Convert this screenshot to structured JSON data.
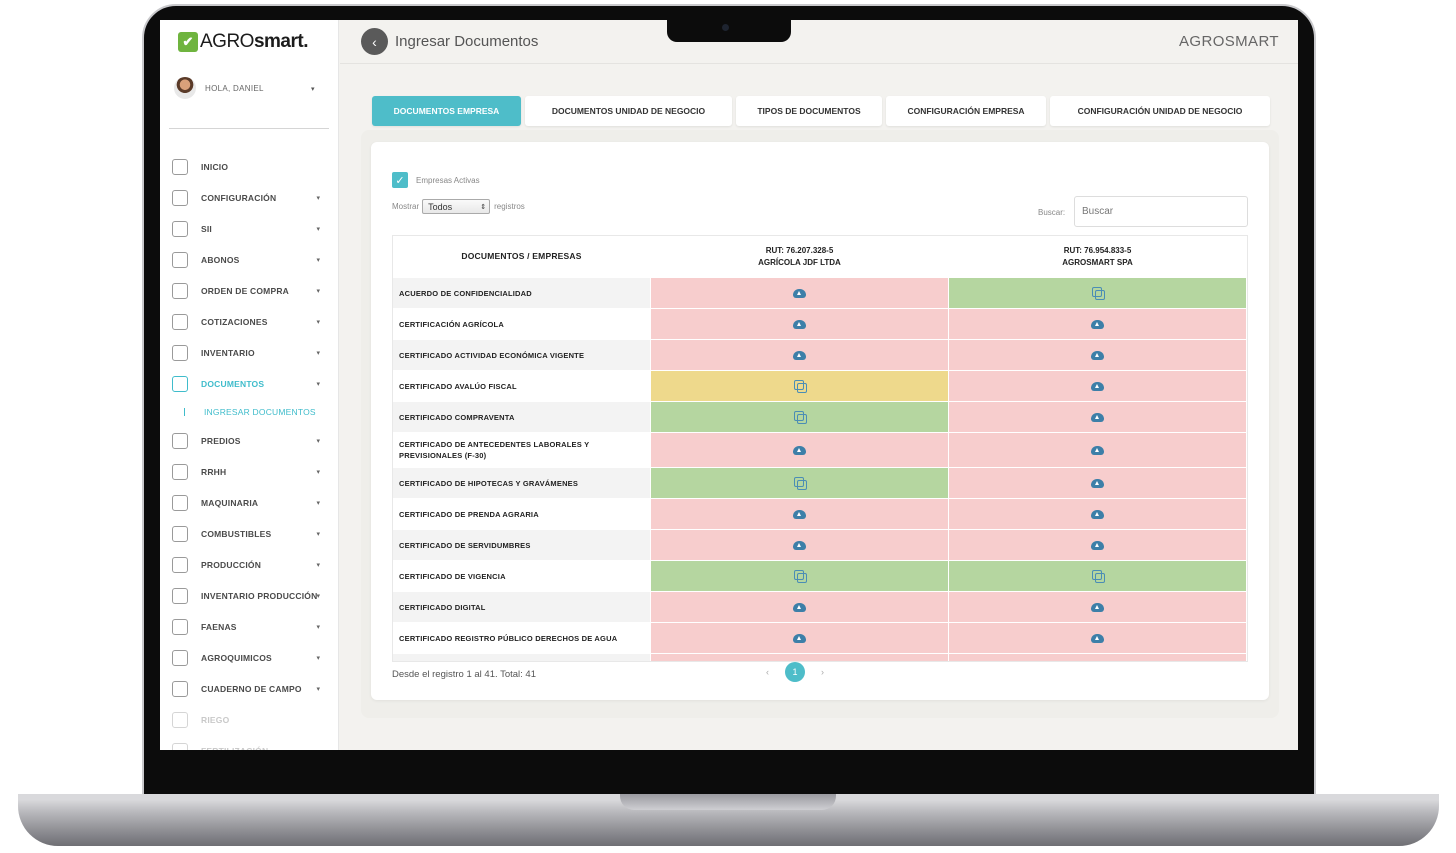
{
  "logo": {
    "mark": "✔",
    "prefix": "AGRO",
    "suffix": "smart."
  },
  "user": {
    "greeting": "HOLA, DANIEL"
  },
  "nav": [
    {
      "label": "INICIO",
      "icon": "dashboard-icon",
      "arrow": ""
    },
    {
      "label": "CONFIGURACIÓN",
      "icon": "gear-icon",
      "arrow": "▾"
    },
    {
      "label": "SII",
      "icon": "invoice-icon",
      "arrow": "▾"
    },
    {
      "label": "ABONOS",
      "icon": "card-icon",
      "arrow": "▾"
    },
    {
      "label": "ORDEN DE COMPRA",
      "icon": "cart-icon",
      "arrow": "▾"
    },
    {
      "label": "COTIZACIONES",
      "icon": "cart-icon",
      "arrow": "▾"
    },
    {
      "label": "INVENTARIO",
      "icon": "tag-icon",
      "arrow": "▾"
    },
    {
      "label": "DOCUMENTOS",
      "icon": "document-icon",
      "arrow": "▾"
    },
    {
      "label": "INGRESAR DOCUMENTOS",
      "icon": "",
      "arrow": ""
    },
    {
      "label": "PREDIOS",
      "icon": "landscape-icon",
      "arrow": "▾"
    },
    {
      "label": "RRHH",
      "icon": "id-card-icon",
      "arrow": "▾"
    },
    {
      "label": "MAQUINARIA",
      "icon": "tractor-icon",
      "arrow": "▾"
    },
    {
      "label": "COMBUSTIBLES",
      "icon": "fuel-icon",
      "arrow": "▾"
    },
    {
      "label": "PRODUCCIÓN",
      "icon": "route-icon",
      "arrow": "▾"
    },
    {
      "label": "INVENTARIO PRODUCCIÓN",
      "icon": "tag-icon",
      "arrow": "▾"
    },
    {
      "label": "FAENAS",
      "icon": "tools-icon",
      "arrow": "▾"
    },
    {
      "label": "AGROQUIMICOS",
      "icon": "calendar-icon",
      "arrow": "▾"
    },
    {
      "label": "CUADERNO DE CAMPO",
      "icon": "notebook-icon",
      "arrow": "▾"
    },
    {
      "label": "RIEGO",
      "icon": "water-icon",
      "arrow": ""
    },
    {
      "label": "FERTILIZACIÓN",
      "icon": "fertilizer-icon",
      "arrow": ""
    }
  ],
  "topbar": {
    "back": "‹",
    "title": "Ingresar Documentos",
    "brand": "AGROSMART"
  },
  "tabs": [
    {
      "label": "DOCUMENTOS EMPRESA"
    },
    {
      "label": "DOCUMENTOS UNIDAD DE NEGOCIO"
    },
    {
      "label": "TIPOS DE DOCUMENTOS"
    },
    {
      "label": "CONFIGURACIÓN EMPRESA"
    },
    {
      "label": "CONFIGURACIÓN UNIDAD DE NEGOCIO"
    }
  ],
  "filters": {
    "active_label": "Empresas Activas",
    "show_label": "Mostrar",
    "show_value": "Todos",
    "records_label": "registros",
    "search_label": "Buscar:",
    "search_placeholder": "Buscar"
  },
  "table": {
    "header": "DOCUMENTOS / EMPRESAS",
    "companies": [
      {
        "rut": "RUT: 76.207.328-5",
        "name": "AGRÍCOLA JDF LTDA"
      },
      {
        "rut": "RUT: 76.954.833-5",
        "name": "AGROSMART SPA"
      }
    ],
    "rows": [
      {
        "doc": "ACUERDO DE CONFIDENCIALIDAD",
        "status": [
          "missing",
          "ok"
        ]
      },
      {
        "doc": "CERTIFICACIÓN AGRÍCOLA",
        "status": [
          "missing",
          "missing"
        ]
      },
      {
        "doc": "CERTIFICADO ACTIVIDAD ECONÓMICA VIGENTE",
        "status": [
          "missing",
          "missing"
        ]
      },
      {
        "doc": "CERTIFICADO AVALÚO FISCAL",
        "status": [
          "warning",
          "missing"
        ]
      },
      {
        "doc": "CERTIFICADO COMPRAVENTA",
        "status": [
          "ok",
          "missing"
        ]
      },
      {
        "doc": "CERTIFICADO DE ANTECEDENTES LABORALES Y PREVISIONALES (F-30)",
        "status": [
          "missing",
          "missing"
        ]
      },
      {
        "doc": "CERTIFICADO DE HIPOTECAS Y GRAVÁMENES",
        "status": [
          "ok",
          "missing"
        ]
      },
      {
        "doc": "CERTIFICADO DE PRENDA AGRARIA",
        "status": [
          "missing",
          "missing"
        ]
      },
      {
        "doc": "CERTIFICADO DE SERVIDUMBRES",
        "status": [
          "missing",
          "missing"
        ]
      },
      {
        "doc": "CERTIFICADO DE VIGENCIA",
        "status": [
          "ok",
          "ok"
        ]
      },
      {
        "doc": "CERTIFICADO DIGITAL",
        "status": [
          "missing",
          "missing"
        ]
      },
      {
        "doc": "CERTIFICADO REGISTRO PÚBLICO DERECHOS DE AGUA",
        "status": [
          "missing",
          "missing"
        ]
      },
      {
        "doc": "",
        "status": [
          "missing",
          "missing"
        ]
      }
    ],
    "status_colors": {
      "missing": "#f7cdcd",
      "ok": "#b5d6a0",
      "warning": "#eed98c"
    }
  },
  "footer": {
    "summary": "Desde el registro 1 al 41. Total: 41",
    "prev": "‹",
    "page": "1",
    "next": "›"
  }
}
